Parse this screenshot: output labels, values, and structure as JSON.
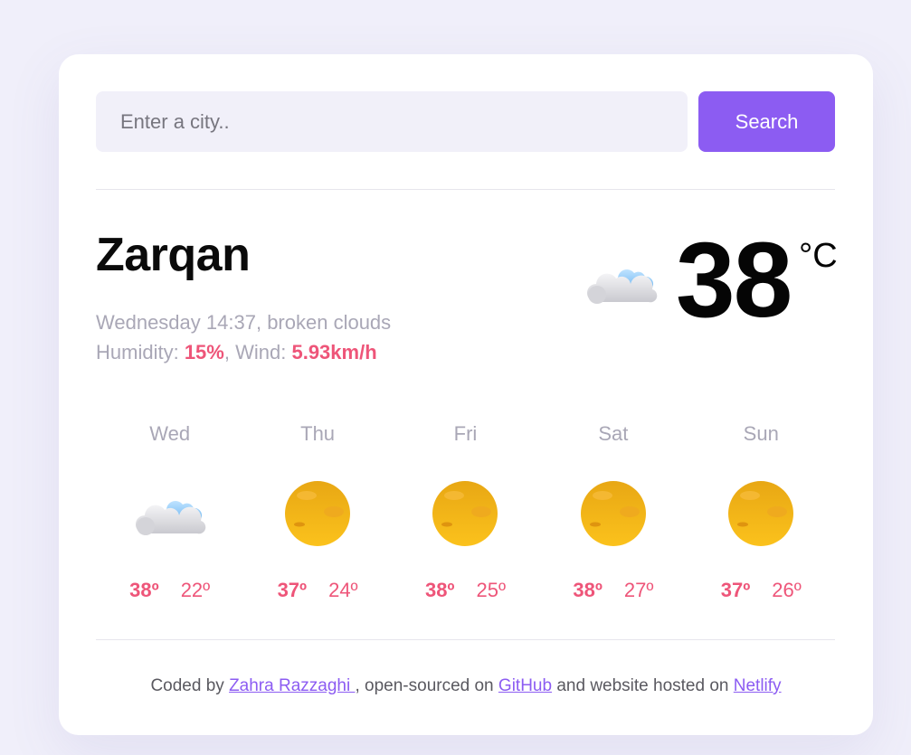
{
  "search": {
    "placeholder": "Enter a city..",
    "button_label": "Search"
  },
  "current": {
    "city": "Zarqan",
    "datetime": "Wednesday 14:37",
    "description": "broken clouds",
    "humidity_label": "Humidity:",
    "humidity": "15%",
    "wind_label": "Wind:",
    "wind": "5.93km/h",
    "temperature": "38",
    "unit": "°C",
    "icon": "broken-clouds-icon"
  },
  "forecast": [
    {
      "day": "Wed",
      "icon": "broken-clouds-icon",
      "max": "38º",
      "min": "22º"
    },
    {
      "day": "Thu",
      "icon": "sun-icon",
      "max": "37º",
      "min": "24º"
    },
    {
      "day": "Fri",
      "icon": "sun-icon",
      "max": "38º",
      "min": "25º"
    },
    {
      "day": "Sat",
      "icon": "sun-icon",
      "max": "38º",
      "min": "27º"
    },
    {
      "day": "Sun",
      "icon": "sun-icon",
      "max": "37º",
      "min": "26º"
    }
  ],
  "footer": {
    "prefix": "Coded by ",
    "author": "Zahra Razzaghi ",
    "middle": ", open-sourced on ",
    "repo_link": "GitHub",
    "suffix": " and website hosted on ",
    "host_link": "Netlify"
  },
  "colors": {
    "accent": "#8c5cf2",
    "highlight": "#ee5579",
    "muted": "#a9a7b6",
    "background": "#f0effa"
  }
}
